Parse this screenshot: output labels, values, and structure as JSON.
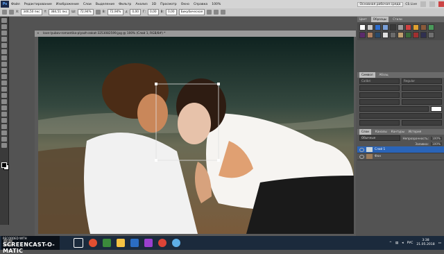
{
  "menubar": {
    "logo": "Ps",
    "items": [
      "Файл",
      "Редактирование",
      "Изображение",
      "Слои",
      "Выделение",
      "Фильтр",
      "Анализ",
      "3D",
      "Просмотр",
      "Окно",
      "Справка"
    ],
    "zoom": "100%",
    "workspace_label": "Основная рабочая среда",
    "cs_live": "CS Live"
  },
  "options": {
    "x_value": "346,50 пкс",
    "y_value": "384,51 пкс",
    "w_value": "72,94%",
    "h_value": "72,94%",
    "angle_value": "0,00",
    "hskew_value": "0,00",
    "vskew_value": "0,00",
    "interp_value": "Бикубическая"
  },
  "document": {
    "tab_title": "love-lyubov-romantika-plyazh-zakat-3253082599.jpg @ 100% (Слой 1, RGB/8#) *"
  },
  "panels": {
    "swatches_tabs": [
      "Цвет",
      "Образцы",
      "Стили"
    ],
    "swatch_colors": [
      "#ffffff",
      "#c8c8c8",
      "#2e6fd0",
      "#7aa0d8",
      "#3a3a3a",
      "#9b9b9b",
      "#d04040",
      "#e0a030",
      "#8a5a3a",
      "#4a9a5a",
      "#5a2a6a",
      "#b08060",
      "#2a4a6a",
      "#e0e0e0",
      "#6a6a6a",
      "#c0a070",
      "#3a6a3a",
      "#a03030",
      "#303050",
      "#707070"
    ],
    "char_tabs": [
      "Символ",
      "Абзац"
    ],
    "font_family": "Calibri",
    "font_style": "Regular",
    "blend_mode": "Обычные",
    "opacity_label": "Непрозрачность:",
    "opacity_value": "100%",
    "fill_label": "Заливка:",
    "fill_value": "100%",
    "layers_tabs": [
      "Слои",
      "Каналы",
      "Контуры",
      "История"
    ],
    "layers": [
      {
        "name": "Слой 1",
        "selected": true
      },
      {
        "name": "Фон",
        "selected": false
      }
    ]
  },
  "taskbar": {
    "lang": "РУС",
    "time": "3:38",
    "date": "21.05.2018",
    "icon_colors": [
      "#ffffff",
      "#e24f31",
      "#3b8a3b",
      "#f6c343",
      "#2b6dc2",
      "#9a3fcf",
      "#5eaee6",
      "#db4437"
    ]
  },
  "watermark": {
    "line1": "RECORDED WITH",
    "line2": "SCREENCAST-O-MATIC"
  }
}
